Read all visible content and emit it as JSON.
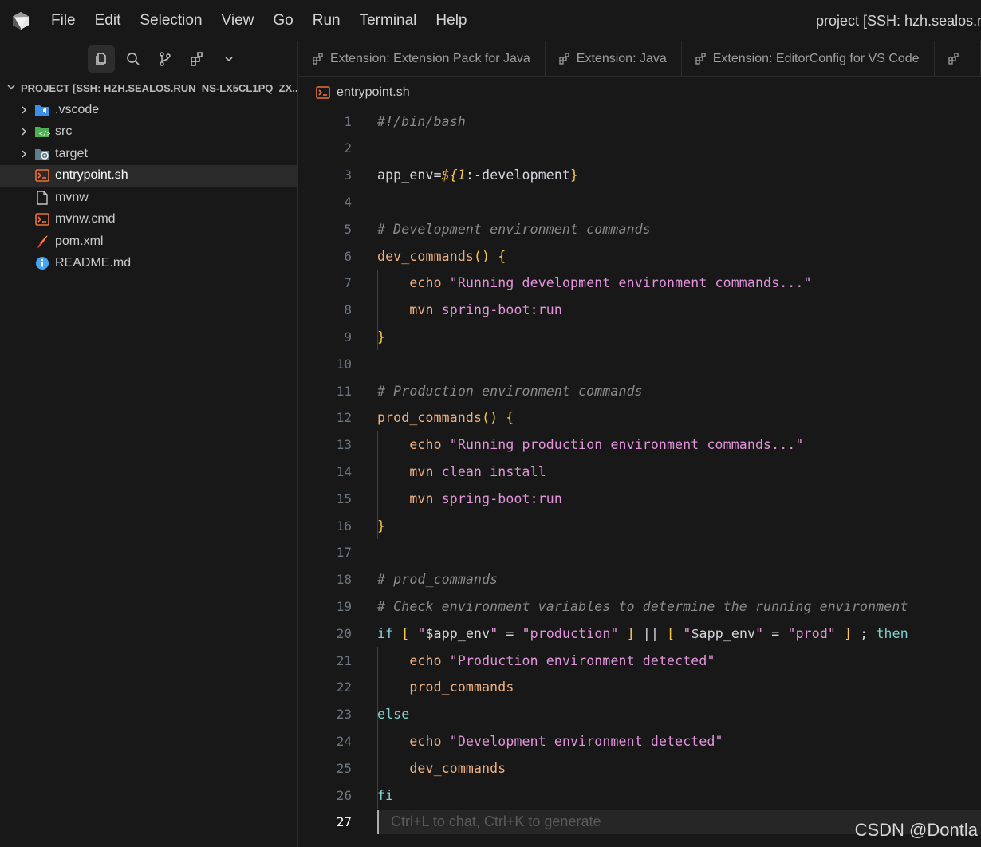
{
  "titlebar": {
    "menu": [
      "File",
      "Edit",
      "Selection",
      "View",
      "Go",
      "Run",
      "Terminal",
      "Help"
    ],
    "window_title": "project [SSH: hzh.sealos.ru"
  },
  "sidebar": {
    "header": "PROJECT [SSH: HZH.SEALOS.RUN_NS-LX5CL1PQ_ZX...",
    "items": [
      {
        "label": ".vscode",
        "type": "folder",
        "icon": "vscode-folder-icon"
      },
      {
        "label": "src",
        "type": "folder",
        "icon": "src-folder-icon"
      },
      {
        "label": "target",
        "type": "folder",
        "icon": "target-folder-icon"
      },
      {
        "label": "entrypoint.sh",
        "type": "file",
        "icon": "shell-file-icon",
        "selected": true
      },
      {
        "label": "mvnw",
        "type": "file",
        "icon": "file-icon"
      },
      {
        "label": "mvnw.cmd",
        "type": "file",
        "icon": "shell-file-icon"
      },
      {
        "label": "pom.xml",
        "type": "file",
        "icon": "maven-file-icon"
      },
      {
        "label": "README.md",
        "type": "file",
        "icon": "info-icon"
      }
    ]
  },
  "tabs": [
    {
      "label": "Extension: Extension Pack for Java"
    },
    {
      "label": "Extension: Java"
    },
    {
      "label": "Extension: EditorConfig for VS Code"
    }
  ],
  "breadcrumb": {
    "file": "entrypoint.sh"
  },
  "editor": {
    "current_line": "27",
    "ghost_hint": "Ctrl+L to chat, Ctrl+K to generate",
    "lines": [
      {
        "n": "1",
        "t": "#!/bin/bash"
      },
      {
        "n": "2",
        "t": ""
      },
      {
        "n": "3",
        "t": "app_env=${1:-development}"
      },
      {
        "n": "4",
        "t": ""
      },
      {
        "n": "5",
        "t": "# Development environment commands"
      },
      {
        "n": "6",
        "t": "dev_commands() {"
      },
      {
        "n": "7",
        "t": "    echo \"Running development environment commands...\""
      },
      {
        "n": "8",
        "t": "    mvn spring-boot:run"
      },
      {
        "n": "9",
        "t": "}"
      },
      {
        "n": "10",
        "t": ""
      },
      {
        "n": "11",
        "t": "# Production environment commands"
      },
      {
        "n": "12",
        "t": "prod_commands() {"
      },
      {
        "n": "13",
        "t": "    echo \"Running production environment commands...\""
      },
      {
        "n": "14",
        "t": "    mvn clean install"
      },
      {
        "n": "15",
        "t": "    mvn spring-boot:run"
      },
      {
        "n": "16",
        "t": "}"
      },
      {
        "n": "17",
        "t": ""
      },
      {
        "n": "18",
        "t": "# prod_commands"
      },
      {
        "n": "19",
        "t": "# Check environment variables to determine the running environment"
      },
      {
        "n": "20",
        "t": "if [ \"$app_env\" = \"production\" ] || [ \"$app_env\" = \"prod\" ] ; then"
      },
      {
        "n": "21",
        "t": "    echo \"Production environment detected\""
      },
      {
        "n": "22",
        "t": "    prod_commands"
      },
      {
        "n": "23",
        "t": "else"
      },
      {
        "n": "24",
        "t": "    echo \"Development environment detected\""
      },
      {
        "n": "25",
        "t": "    dev_commands"
      },
      {
        "n": "26",
        "t": "fi"
      },
      {
        "n": "27",
        "t": ""
      }
    ]
  },
  "watermark": "CSDN @Dontla",
  "colors": {
    "background": "#181818",
    "comment": "#8b8b8b",
    "function": "#efb080",
    "keyword": "#82d2ce",
    "string": "#e394dc",
    "brace": "#f7c948"
  }
}
